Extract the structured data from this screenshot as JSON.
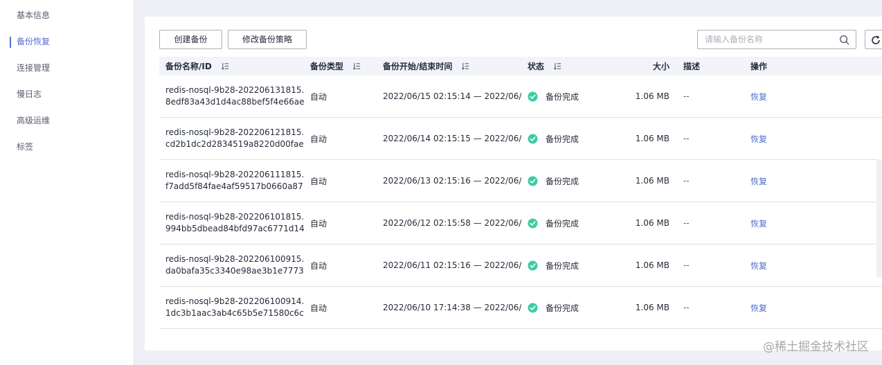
{
  "sidebar": {
    "items": [
      {
        "label": "基本信息",
        "active": false
      },
      {
        "label": "备份恢复",
        "active": true
      },
      {
        "label": "连接管理",
        "active": false
      },
      {
        "label": "慢日志",
        "active": false
      },
      {
        "label": "高级运维",
        "active": false
      },
      {
        "label": "标签",
        "active": false
      }
    ]
  },
  "toolbar": {
    "create_label": "创建备份",
    "policy_label": "修改备份策略",
    "search_placeholder": "请输入备份名称"
  },
  "table": {
    "headers": {
      "name": "备份名称/ID",
      "type": "备份类型",
      "time": "备份开始/结束时间",
      "status": "状态",
      "size": "大小",
      "desc": "描述",
      "op": "操作"
    },
    "rows": [
      {
        "name": "redis-nosql-9b28-202206131815...",
        "id": "8edf83a43d1d4ac88bef5f4e66ae...",
        "type": "自动",
        "time": "2022/06/15 02:15:14 — 2022/06/...",
        "status": "备份完成",
        "size": "1.06 MB",
        "desc": "--",
        "op": "恢复"
      },
      {
        "name": "redis-nosql-9b28-202206121815...",
        "id": "cd2b1dc2d2834519a8220d00fae...",
        "type": "自动",
        "time": "2022/06/14 02:15:15 — 2022/06/...",
        "status": "备份完成",
        "size": "1.06 MB",
        "desc": "--",
        "op": "恢复"
      },
      {
        "name": "redis-nosql-9b28-202206111815...",
        "id": "f7add5f84fae4af59517b0660a87...",
        "type": "自动",
        "time": "2022/06/13 02:15:16 — 2022/06/...",
        "status": "备份完成",
        "size": "1.06 MB",
        "desc": "--",
        "op": "恢复"
      },
      {
        "name": "redis-nosql-9b28-202206101815...",
        "id": "994bb5dbead84bfd97ac6771d14...",
        "type": "自动",
        "time": "2022/06/12 02:15:58 — 2022/06/...",
        "status": "备份完成",
        "size": "1.06 MB",
        "desc": "--",
        "op": "恢复"
      },
      {
        "name": "redis-nosql-9b28-202206100915...",
        "id": "da0bafa35c3340e98ae3b1e7773...",
        "type": "自动",
        "time": "2022/06/11 02:15:16 — 2022/06/...",
        "status": "备份完成",
        "size": "1.06 MB",
        "desc": "--",
        "op": "恢复"
      },
      {
        "name": "redis-nosql-9b28-202206100914...",
        "id": "1dc3b1aac3ab4c65b5e71580c6c...",
        "type": "自动",
        "time": "2022/06/10 17:14:38 — 2022/06/...",
        "status": "备份完成",
        "size": "1.06 MB",
        "desc": "--",
        "op": "恢复"
      }
    ]
  },
  "colors": {
    "accent": "#526ecc",
    "success": "#3dcca6"
  },
  "icons": {
    "search": "search-icon",
    "refresh": "refresh-icon",
    "sort": "sort-icon",
    "status_ok": "check-circle-icon"
  },
  "watermark": "@稀土掘金技术社区"
}
